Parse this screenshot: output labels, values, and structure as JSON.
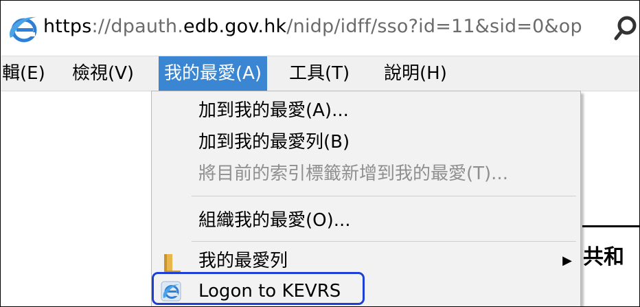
{
  "address_bar": {
    "url_scheme": "https",
    "url_sep": "://dpauth.",
    "url_host": "edb.gov.hk",
    "url_path": "/nidp/idff/sso?id=11&sid=0&op"
  },
  "menubar": {
    "items": [
      {
        "label": "輯(E)"
      },
      {
        "label": "檢視(V)"
      },
      {
        "label": "我的最愛(A)"
      },
      {
        "label": "工具(T)"
      },
      {
        "label": "說明(H)"
      }
    ]
  },
  "dropdown": {
    "items": [
      {
        "label": "加到我的最愛(A)..."
      },
      {
        "label": "加到我的最愛列(B)"
      },
      {
        "label": "將目前的索引標籤新增到我的最愛(T)..."
      },
      {
        "label": "組織我的最愛(O)..."
      },
      {
        "label": "我的最愛列"
      },
      {
        "label": "Logon to KEVRS"
      }
    ]
  },
  "page": {
    "partial_text": "共和"
  },
  "colors": {
    "menu_active": "#3a86d2",
    "highlight_box": "#1c3fd6",
    "ie_blue": "#2f7fd6",
    "folder": "#e8b64a"
  },
  "icons": [
    "ie-logo-icon",
    "search-icon",
    "folder-icon",
    "submenu-arrow-icon"
  ]
}
